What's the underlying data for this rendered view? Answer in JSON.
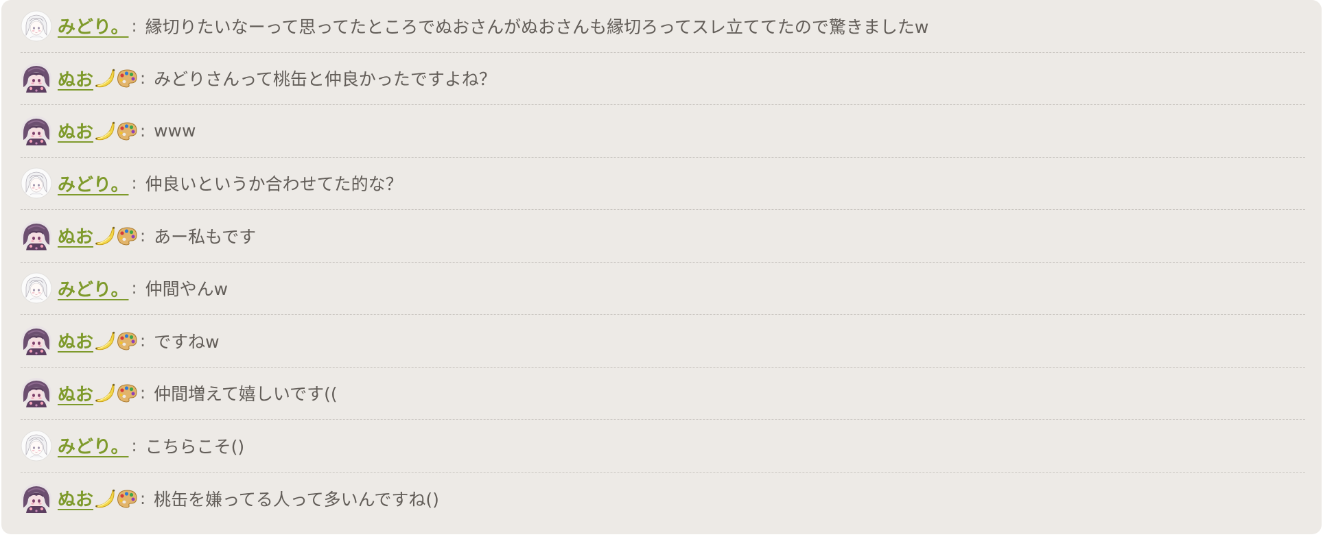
{
  "users": {
    "midori": {
      "name": "みどり。",
      "avatar": "white-haired-girl-avatar-icon",
      "badges": []
    },
    "nuo": {
      "name": "ぬお",
      "avatar": "purple-haired-girl-avatar-icon",
      "badges": [
        "banana-icon",
        "paint-palette-icon"
      ]
    }
  },
  "colors": {
    "panel_background": "#edeae6",
    "username": "#7e9a2b",
    "message_text": "#625d58",
    "divider": "#c9c5c0"
  },
  "separator": ":",
  "messages": [
    {
      "user": "midori",
      "text": "縁切りたいなーって思ってたところでぬおさんがぬおさんも縁切ろってスレ立ててたので驚きましたw"
    },
    {
      "user": "nuo",
      "text": "みどりさんって桃缶と仲良かったですよね？"
    },
    {
      "user": "nuo",
      "text": "www"
    },
    {
      "user": "midori",
      "text": "仲良いというか合わせてた的な？"
    },
    {
      "user": "nuo",
      "text": "あー私もです"
    },
    {
      "user": "midori",
      "text": "仲間やんw"
    },
    {
      "user": "nuo",
      "text": "ですねw"
    },
    {
      "user": "nuo",
      "text": "仲間増えて嬉しいです(("
    },
    {
      "user": "midori",
      "text": "こちらこそ()"
    },
    {
      "user": "nuo",
      "text": "桃缶を嫌ってる人って多いんですね()"
    }
  ]
}
